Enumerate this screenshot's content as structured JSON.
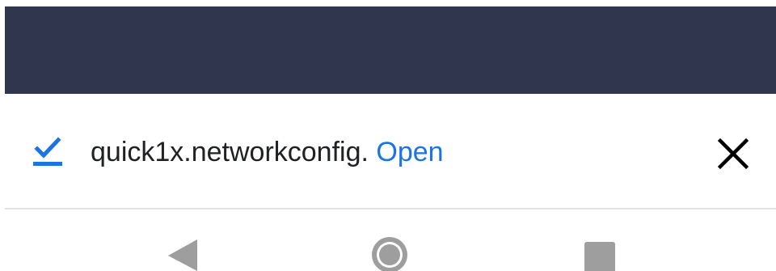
{
  "colors": {
    "app_bar": "#2f364d",
    "accent": "#1a73e8",
    "text": "#202124",
    "nav_icon": "#9e9e9e"
  },
  "download_bar": {
    "status_icon": "check-underline-icon",
    "file_name": "quick1x.networkconfig.",
    "open_label": "Open",
    "close_icon": "close-icon"
  },
  "nav_bar": {
    "back_icon": "back-triangle-icon",
    "home_icon": "home-circle-icon",
    "recents_icon": "recents-square-icon"
  }
}
